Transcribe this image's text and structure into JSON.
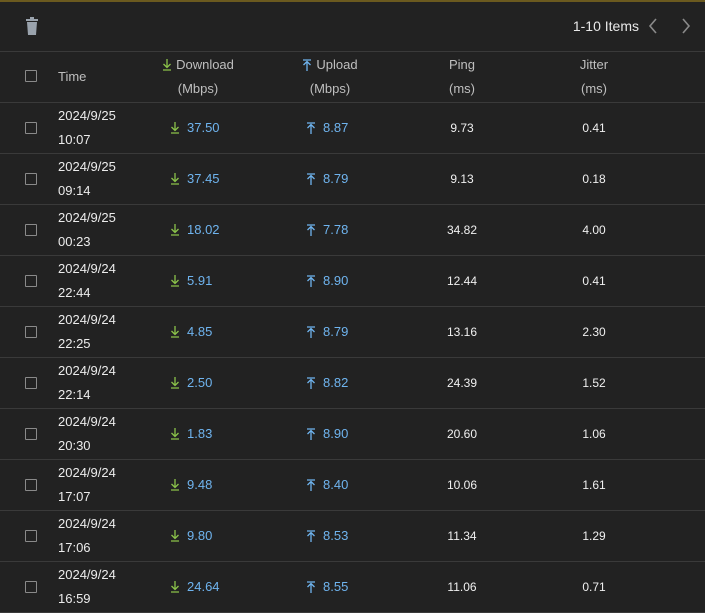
{
  "toolbar": {
    "pager_text": "1-10 Items"
  },
  "columns": {
    "time": "Time",
    "download": "Download",
    "download_unit": "(Mbps)",
    "upload": "Upload",
    "upload_unit": "(Mbps)",
    "ping": "Ping",
    "ping_unit": "(ms)",
    "jitter": "Jitter",
    "jitter_unit": "(ms)"
  },
  "icons": {
    "delete": "trash-icon",
    "prev": "chevron-left-icon",
    "next": "chevron-right-icon",
    "download": "arrow-down-icon",
    "upload": "arrow-up-icon"
  },
  "colors": {
    "download_icon": "#8bc34a",
    "upload_icon": "#6fb4ef",
    "value_blue": "#6fb4ef"
  },
  "rows": [
    {
      "date": "2024/9/25",
      "time": "10:07",
      "download": "37.50",
      "upload": "8.87",
      "ping": "9.73",
      "jitter": "0.41"
    },
    {
      "date": "2024/9/25",
      "time": "09:14",
      "download": "37.45",
      "upload": "8.79",
      "ping": "9.13",
      "jitter": "0.18"
    },
    {
      "date": "2024/9/25",
      "time": "00:23",
      "download": "18.02",
      "upload": "7.78",
      "ping": "34.82",
      "jitter": "4.00"
    },
    {
      "date": "2024/9/24",
      "time": "22:44",
      "download": "5.91",
      "upload": "8.90",
      "ping": "12.44",
      "jitter": "0.41"
    },
    {
      "date": "2024/9/24",
      "time": "22:25",
      "download": "4.85",
      "upload": "8.79",
      "ping": "13.16",
      "jitter": "2.30"
    },
    {
      "date": "2024/9/24",
      "time": "22:14",
      "download": "2.50",
      "upload": "8.82",
      "ping": "24.39",
      "jitter": "1.52"
    },
    {
      "date": "2024/9/24",
      "time": "20:30",
      "download": "1.83",
      "upload": "8.90",
      "ping": "20.60",
      "jitter": "1.06"
    },
    {
      "date": "2024/9/24",
      "time": "17:07",
      "download": "9.48",
      "upload": "8.40",
      "ping": "10.06",
      "jitter": "1.61"
    },
    {
      "date": "2024/9/24",
      "time": "17:06",
      "download": "9.80",
      "upload": "8.53",
      "ping": "11.34",
      "jitter": "1.29"
    },
    {
      "date": "2024/9/24",
      "time": "16:59",
      "download": "24.64",
      "upload": "8.55",
      "ping": "11.06",
      "jitter": "0.71"
    }
  ]
}
